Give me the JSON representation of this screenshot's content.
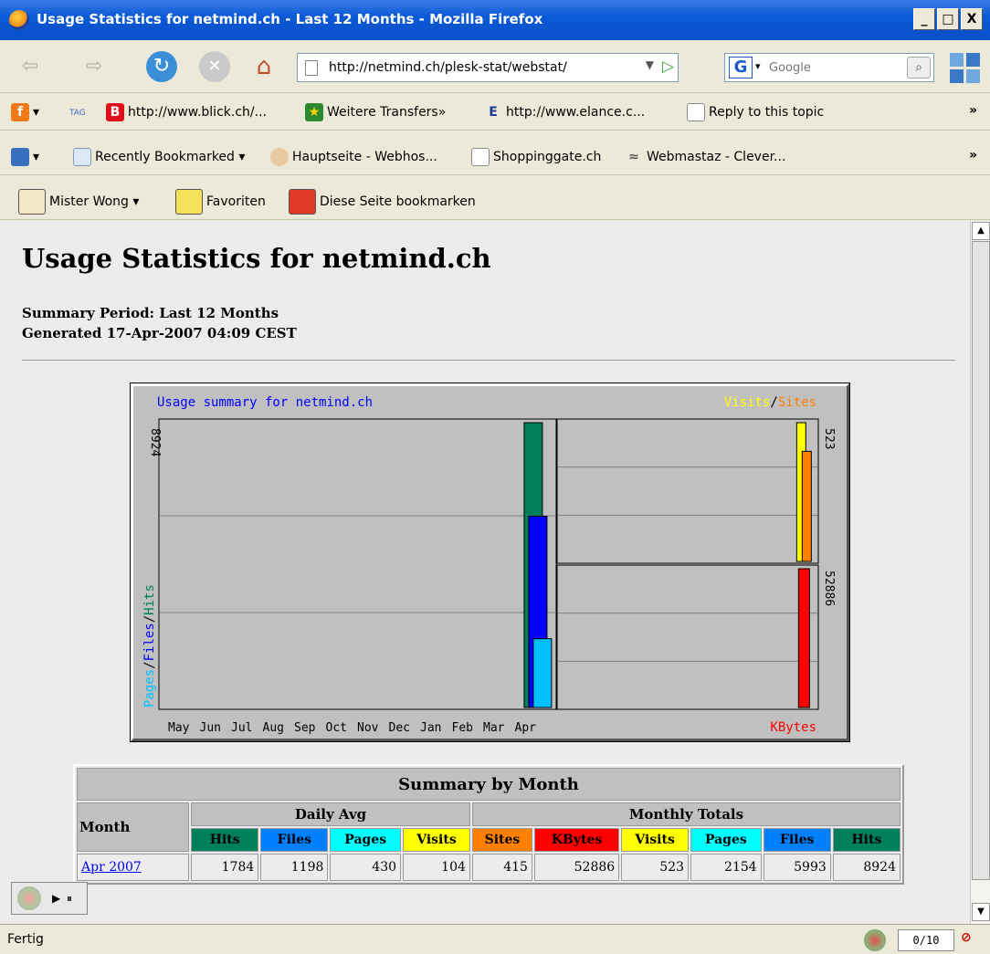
{
  "window": {
    "title": "Usage Statistics for netmind.ch - Last 12 Months - Mozilla Firefox",
    "buttons": [
      "_",
      "□",
      "X"
    ]
  },
  "navbar": {
    "url": "http://netmind.ch/plesk-stat/webstat/",
    "search_placeholder": "Google",
    "search_engine_letter": "G"
  },
  "bookmarks1": {
    "items": [
      {
        "label": "http://www.blick.ch/..."
      },
      {
        "label": "Weitere Transfers»"
      },
      {
        "label": "http://www.elance.c..."
      },
      {
        "label": "Reply to this topic"
      }
    ],
    "tag_label": "TAG",
    "blick_letter": "B",
    "elance_letter": "E",
    "overflow": "»"
  },
  "bookmarks2": {
    "items": [
      {
        "label": "Recently Bookmarked"
      },
      {
        "label": "Hauptseite - Webhos..."
      },
      {
        "label": "Shoppinggate.ch"
      },
      {
        "label": "Webmastaz - Clever..."
      }
    ],
    "overflow": "»"
  },
  "bookmarks3": {
    "items": [
      {
        "label": "Mister Wong"
      },
      {
        "label": "Favoriten"
      },
      {
        "label": "Diese Seite bookmarken"
      }
    ]
  },
  "page": {
    "heading": "Usage Statistics for netmind.ch",
    "summary_period": "Summary Period: Last 12 Months",
    "generated": "Generated 17-Apr-2007 04:09 CEST"
  },
  "chart_data": {
    "type": "bar",
    "title": "Usage summary for netmind.ch",
    "categories": [
      "May",
      "Jun",
      "Jul",
      "Aug",
      "Sep",
      "Oct",
      "Nov",
      "Dec",
      "Jan",
      "Feb",
      "Mar",
      "Apr"
    ],
    "left_panel": {
      "ylabel_parts": [
        "Pages",
        "/",
        "Files",
        "/",
        "Hits"
      ],
      "ymax_label": "8924",
      "ymax": 8924,
      "series": [
        {
          "name": "Hits",
          "color": "#00805a",
          "values": [
            0,
            0,
            0,
            0,
            0,
            0,
            0,
            0,
            0,
            0,
            0,
            8924
          ]
        },
        {
          "name": "Files",
          "color": "#0000ff",
          "values": [
            0,
            0,
            0,
            0,
            0,
            0,
            0,
            0,
            0,
            0,
            0,
            5993
          ]
        },
        {
          "name": "Pages",
          "color": "#00c0ff",
          "values": [
            0,
            0,
            0,
            0,
            0,
            0,
            0,
            0,
            0,
            0,
            0,
            2154
          ]
        }
      ]
    },
    "top_right_panel": {
      "legend_parts": [
        "Visits",
        "/",
        "Sites"
      ],
      "ymax_label": "523",
      "ymax": 523,
      "series": [
        {
          "name": "Visits",
          "color": "#ffff00",
          "values": [
            0,
            0,
            0,
            0,
            0,
            0,
            0,
            0,
            0,
            0,
            0,
            523
          ]
        },
        {
          "name": "Sites",
          "color": "#ff8000",
          "values": [
            0,
            0,
            0,
            0,
            0,
            0,
            0,
            0,
            0,
            0,
            0,
            415
          ]
        }
      ]
    },
    "bottom_right_panel": {
      "legend": "KBytes",
      "ymax_label": "52886",
      "ymax": 52886,
      "series": [
        {
          "name": "KBytes",
          "color": "#ff0000",
          "values": [
            0,
            0,
            0,
            0,
            0,
            0,
            0,
            0,
            0,
            0,
            0,
            52886
          ]
        }
      ]
    },
    "grid": true
  },
  "table": {
    "caption": "Summary by Month",
    "month_header": "Month",
    "daily_avg_header": "Daily Avg",
    "monthly_totals_header": "Monthly Totals",
    "daily_cols": [
      {
        "label": "Hits",
        "color": "#00805a",
        "text": "#000"
      },
      {
        "label": "Files",
        "color": "#0080ff",
        "text": "#000"
      },
      {
        "label": "Pages",
        "color": "#00ffff",
        "text": "#000"
      },
      {
        "label": "Visits",
        "color": "#ffff00",
        "text": "#000"
      }
    ],
    "total_cols": [
      {
        "label": "Sites",
        "color": "#ff8000",
        "text": "#000"
      },
      {
        "label": "KBytes",
        "color": "#ff0000",
        "text": "#000"
      },
      {
        "label": "Visits",
        "color": "#ffff00",
        "text": "#000"
      },
      {
        "label": "Pages",
        "color": "#00ffff",
        "text": "#000"
      },
      {
        "label": "Files",
        "color": "#0080ff",
        "text": "#000"
      },
      {
        "label": "Hits",
        "color": "#00805a",
        "text": "#000"
      }
    ],
    "rows": [
      {
        "month": "Apr 2007",
        "values": [
          "1784",
          "1198",
          "430",
          "104",
          "415",
          "52886",
          "523",
          "2154",
          "5993",
          "8924"
        ]
      }
    ]
  },
  "status": {
    "text": "Fertig",
    "counter": "0/10"
  }
}
